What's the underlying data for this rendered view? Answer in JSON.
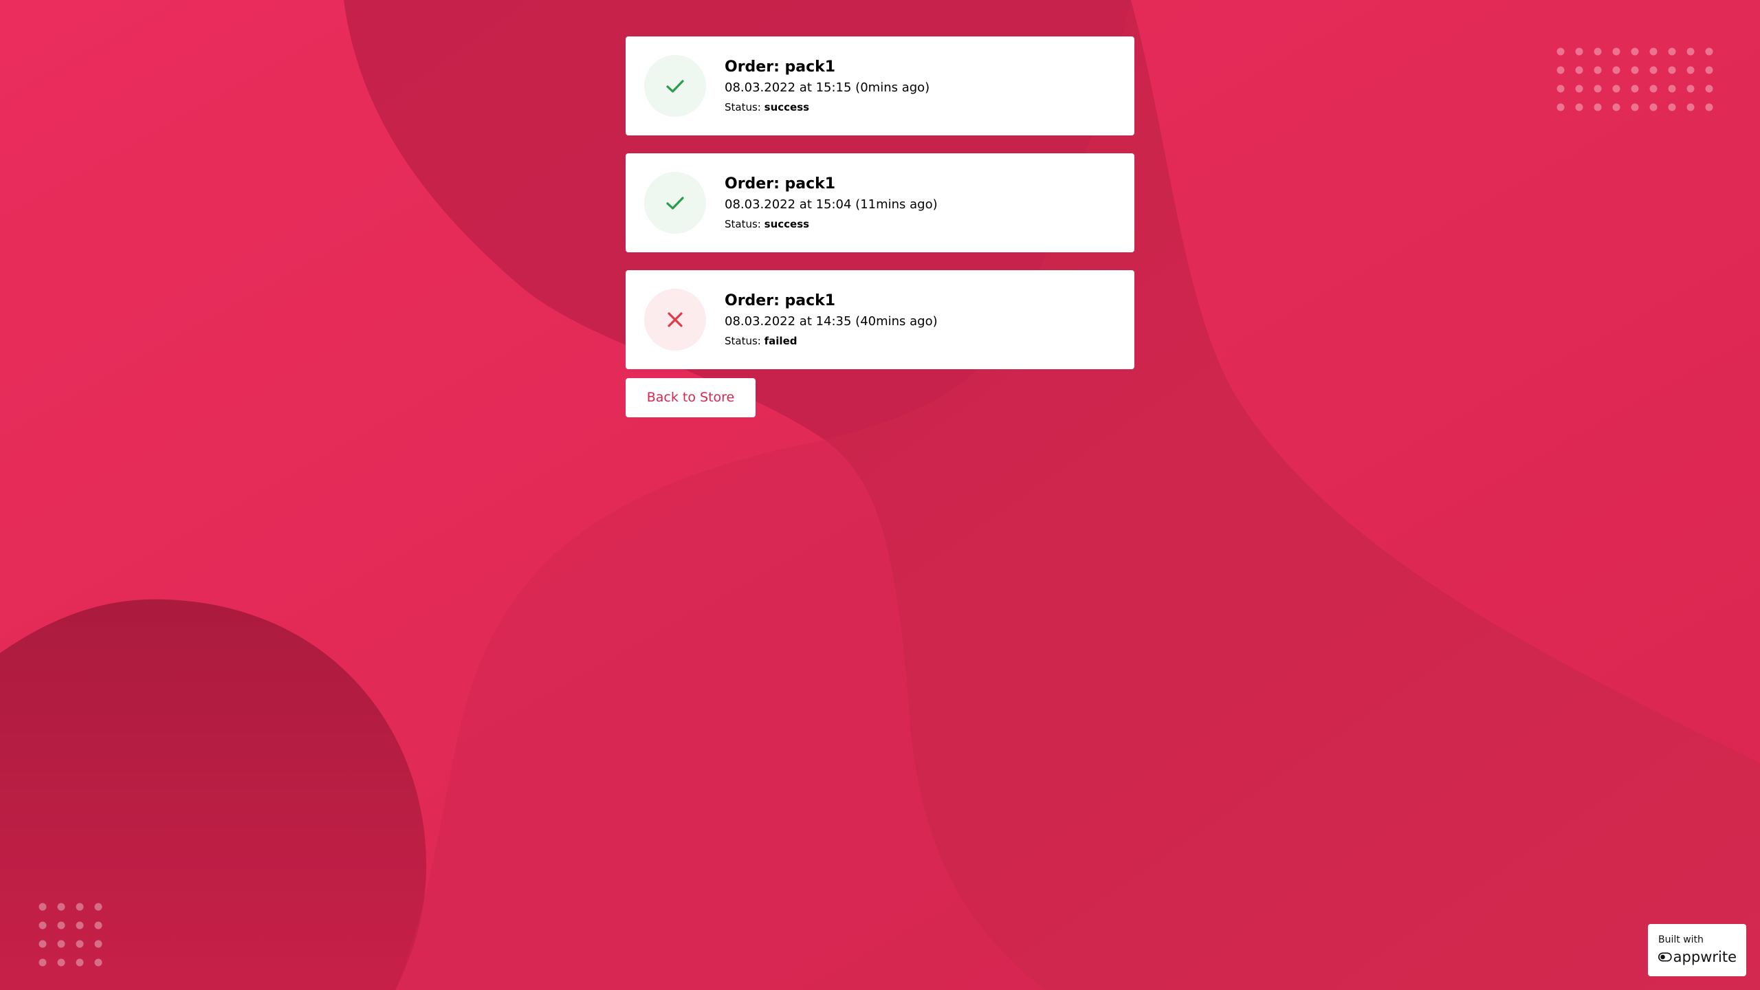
{
  "orders": [
    {
      "title": "Order: pack1",
      "date": "08.03.2022 at 15:15 (0mins ago)",
      "status_label": "Status:",
      "status_value": "success",
      "status_icon": "check-icon"
    },
    {
      "title": "Order: pack1",
      "date": "08.03.2022 at 15:04 (11mins ago)",
      "status_label": "Status:",
      "status_value": "success",
      "status_icon": "check-icon"
    },
    {
      "title": "Order: pack1",
      "date": "08.03.2022 at 14:35 (40mins ago)",
      "status_label": "Status:",
      "status_value": "failed",
      "status_icon": "close-icon"
    }
  ],
  "back_button": {
    "label": "Back to Store"
  },
  "badge": {
    "caption": "Built with",
    "wordmark": "appwrite",
    "logo_icon": "appwrite-logo-icon"
  },
  "colors": {
    "background": "#d9264f",
    "accent": "#d9264f",
    "success": "#2a9c4a",
    "failed": "#e23b48"
  }
}
